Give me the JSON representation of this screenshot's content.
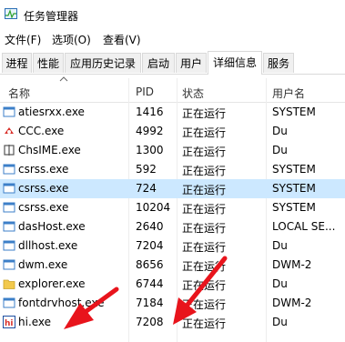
{
  "window": {
    "title": "任务管理器",
    "icon": "task-manager-icon"
  },
  "menu": [
    "文件(F)",
    "选项(O)",
    "查看(V)"
  ],
  "tabs": [
    {
      "label": "进程",
      "active": false
    },
    {
      "label": "性能",
      "active": false
    },
    {
      "label": "应用历史记录",
      "active": false
    },
    {
      "label": "启动",
      "active": false
    },
    {
      "label": "用户",
      "active": false
    },
    {
      "label": "详细信息",
      "active": true
    },
    {
      "label": "服务",
      "active": false
    }
  ],
  "columns": [
    "名称",
    "PID",
    "状态",
    "用户名"
  ],
  "rows": [
    {
      "name": "atiesrxx.exe",
      "pid": "1416",
      "status": "正在运行",
      "user": "SYSTEM",
      "icon": "window-app-icon",
      "selected": false
    },
    {
      "name": "CCC.exe",
      "pid": "4992",
      "status": "正在运行",
      "user": "Du",
      "icon": "catalyst-icon",
      "selected": false
    },
    {
      "name": "ChsIME.exe",
      "pid": "1300",
      "status": "正在运行",
      "user": "Du",
      "icon": "ime-icon",
      "selected": false
    },
    {
      "name": "csrss.exe",
      "pid": "592",
      "status": "正在运行",
      "user": "SYSTEM",
      "icon": "window-app-icon",
      "selected": false
    },
    {
      "name": "csrss.exe",
      "pid": "724",
      "status": "正在运行",
      "user": "SYSTEM",
      "icon": "window-app-icon",
      "selected": true
    },
    {
      "name": "csrss.exe",
      "pid": "10204",
      "status": "正在运行",
      "user": "SYSTEM",
      "icon": "window-app-icon",
      "selected": false
    },
    {
      "name": "dasHost.exe",
      "pid": "2640",
      "status": "正在运行",
      "user": "LOCAL SE...",
      "icon": "window-app-icon",
      "selected": false
    },
    {
      "name": "dllhost.exe",
      "pid": "7204",
      "status": "正在运行",
      "user": "Du",
      "icon": "window-app-icon",
      "selected": false
    },
    {
      "name": "dwm.exe",
      "pid": "8656",
      "status": "正在运行",
      "user": "DWM-2",
      "icon": "window-app-icon",
      "selected": false
    },
    {
      "name": "explorer.exe",
      "pid": "6744",
      "status": "正在运行",
      "user": "Du",
      "icon": "folder-icon",
      "selected": false
    },
    {
      "name": "fontdrvhost.exe",
      "pid": "7184",
      "status": "正在运行",
      "user": "DWM-2",
      "icon": "window-app-icon",
      "selected": false
    },
    {
      "name": "hi.exe",
      "pid": "7208",
      "status": "正在运行",
      "user": "Du",
      "icon": "hi-app-icon",
      "selected": false
    }
  ],
  "colors": {
    "selected_row": "#cce8ff",
    "arrow": "#e8141c",
    "icon_blue": "#3c7fc8"
  }
}
